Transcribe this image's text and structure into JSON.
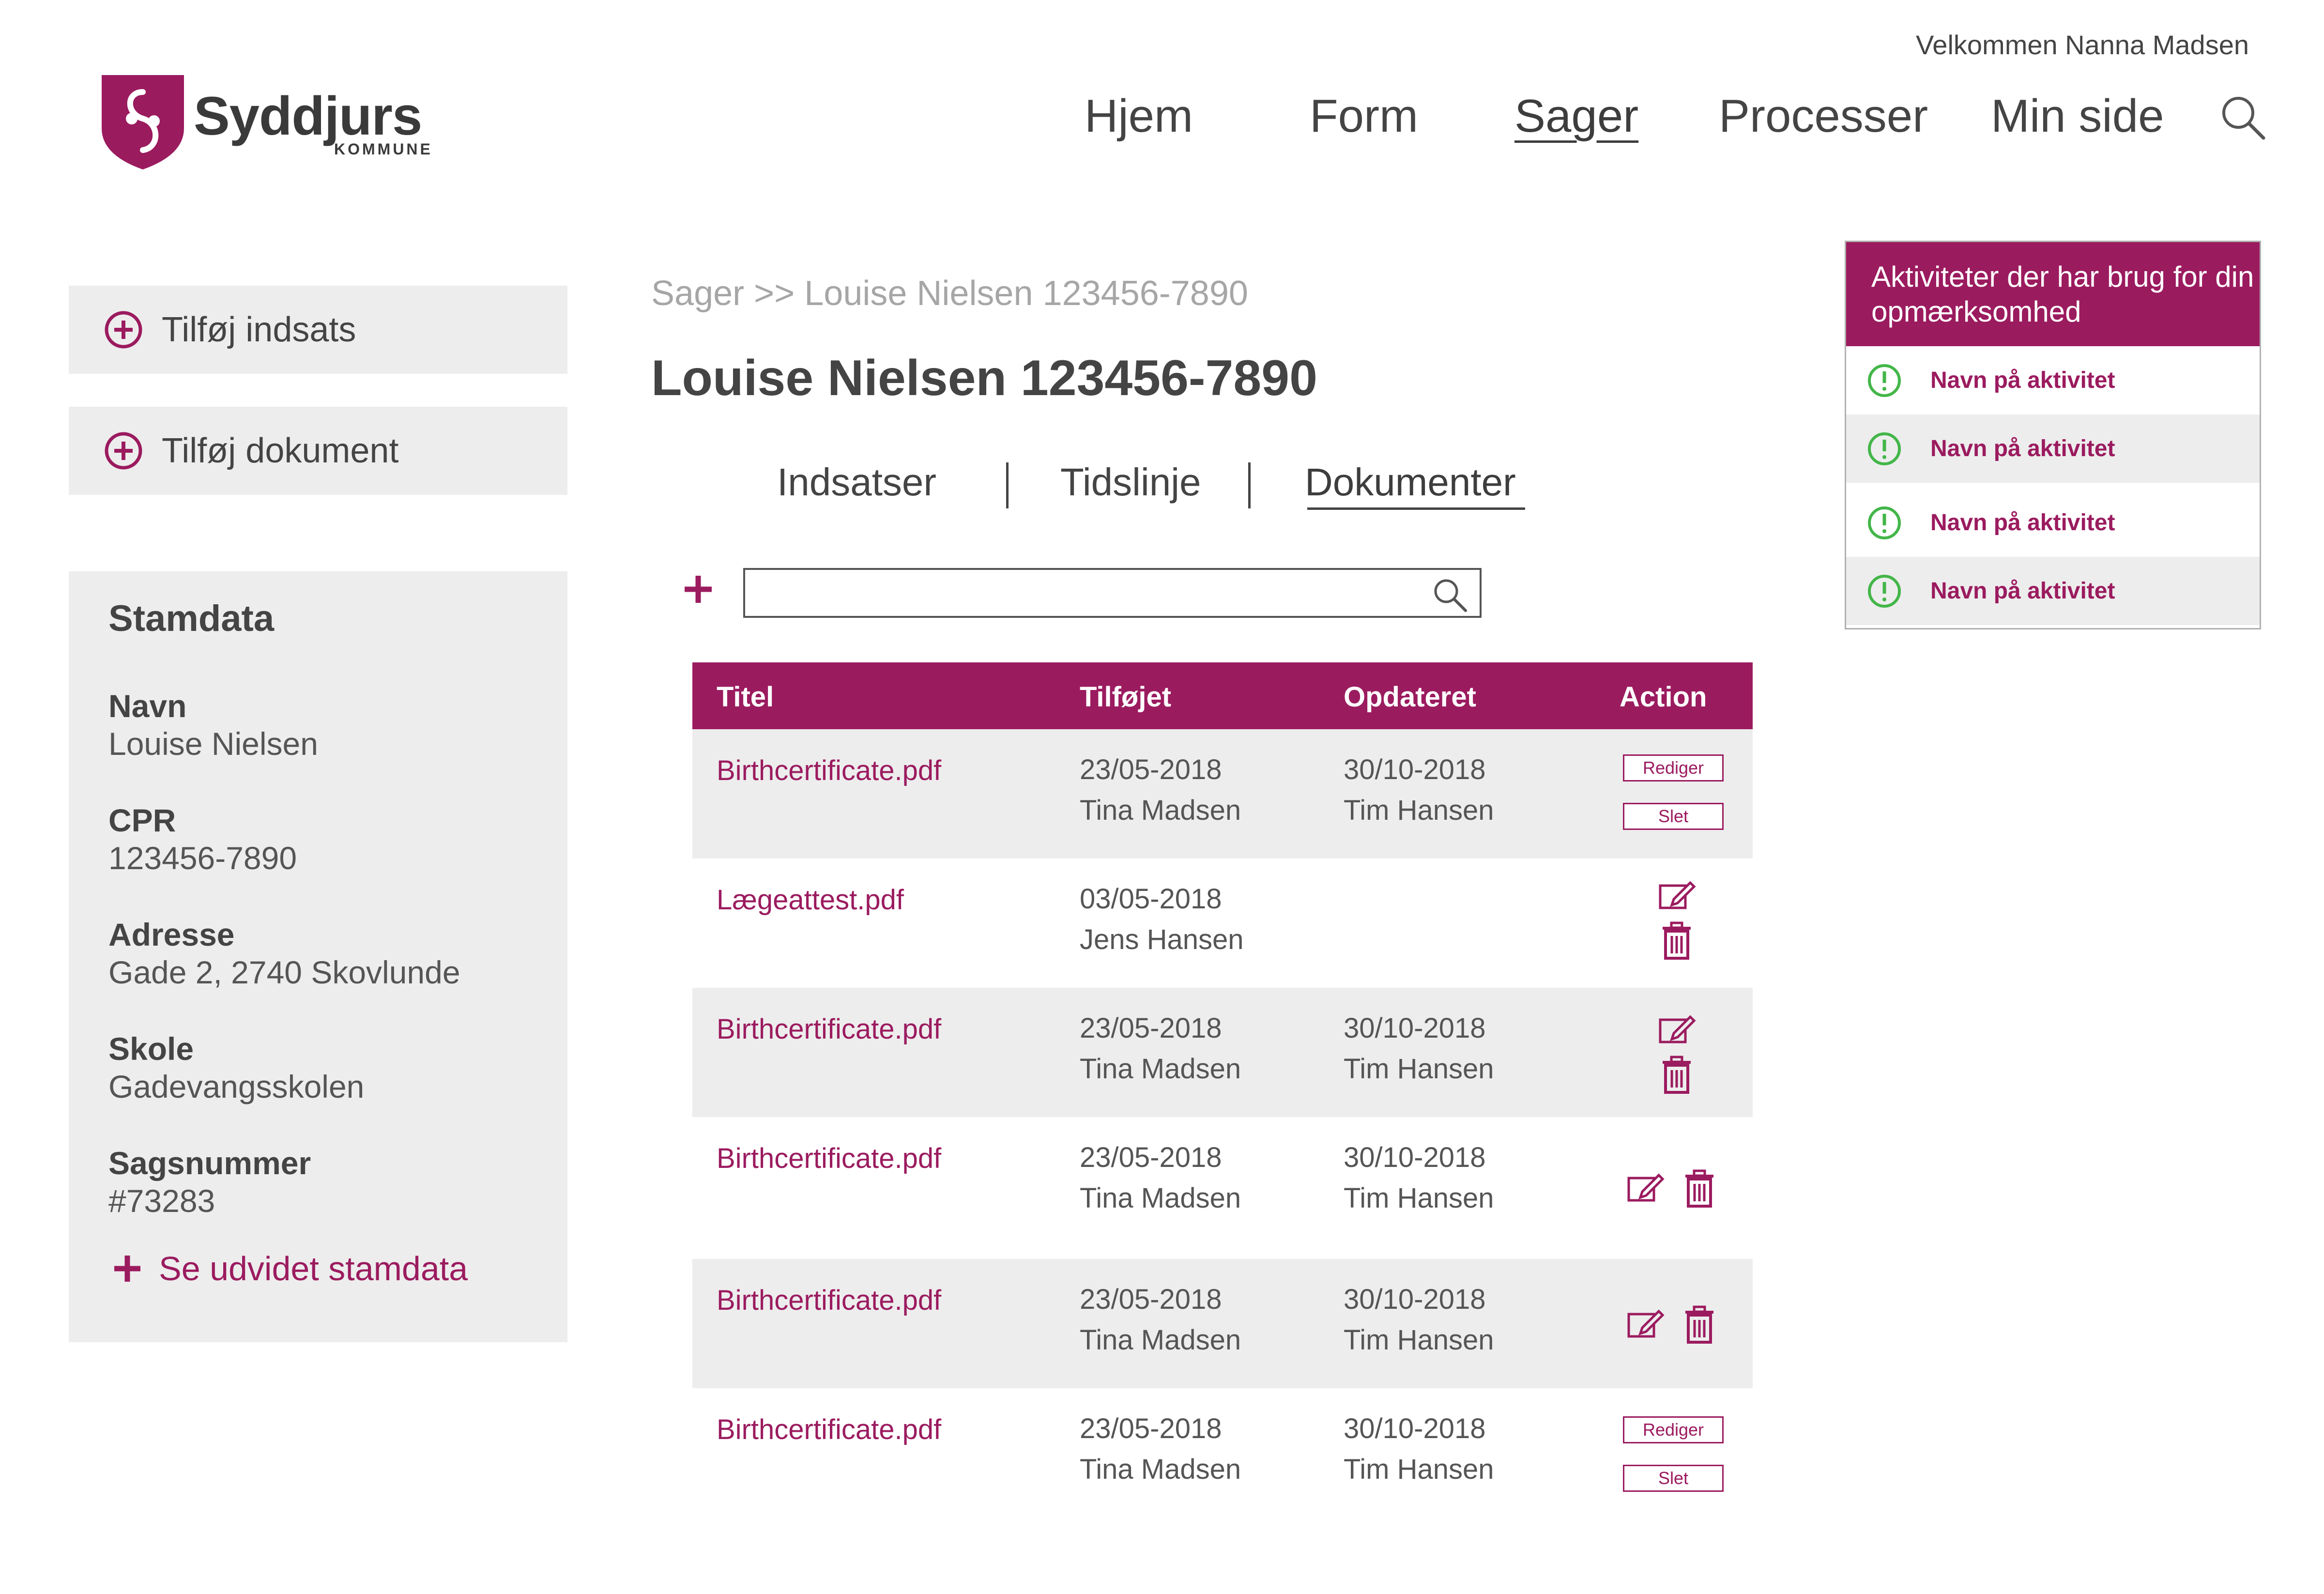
{
  "header": {
    "welcome": "Velkommen Nanna Madsen",
    "logo": {
      "name": "Syddjurs",
      "sub": "KOMMUNE"
    },
    "nav": [
      "Hjem",
      "Form",
      "Sager",
      "Processer",
      "Min side"
    ],
    "active_nav": "Sager"
  },
  "sidebar": {
    "add_effort": "Tilføj indsats",
    "add_document": "Tilføj dokument",
    "stamdata": {
      "title": "Stamdata",
      "fields": [
        {
          "label": "Navn",
          "value": "Louise Nielsen"
        },
        {
          "label": "CPR",
          "value": "123456-7890"
        },
        {
          "label": "Adresse",
          "value": "Gade 2, 2740 Skovlunde"
        },
        {
          "label": "Skole",
          "value": "Gadevangsskolen"
        },
        {
          "label": "Sagsnummer",
          "value": "#73283"
        }
      ],
      "more": "Se udvidet stamdata"
    }
  },
  "main": {
    "breadcrumb": "Sager >> Louise Nielsen 123456-7890",
    "title": "Louise Nielsen 123456-7890",
    "tabs": [
      "Indsatser",
      "Tidslinje",
      "Dokumenter"
    ],
    "active_tab": "Dokumenter",
    "search": {
      "value": "",
      "placeholder": ""
    },
    "table": {
      "headers": {
        "title": "Titel",
        "added": "Tilføjet",
        "updated": "Opdateret",
        "action": "Action"
      },
      "rows": [
        {
          "title": "Birthcertificate.pdf",
          "added_date": "23/05-2018",
          "added_by": "Tina Madsen",
          "updated_date": "30/10-2018",
          "updated_by": "Tim Hansen",
          "actions": [
            "Rediger",
            "Slet"
          ]
        },
        {
          "title": "Lægeattest.pdf",
          "added_date": "03/05-2018",
          "added_by": "Jens Hansen",
          "updated_date": "",
          "updated_by": ""
        },
        {
          "title": "Birthcertificate.pdf",
          "added_date": "23/05-2018",
          "added_by": "Tina Madsen",
          "updated_date": "30/10-2018",
          "updated_by": "Tim Hansen"
        },
        {
          "title": "Birthcertificate.pdf",
          "added_date": "23/05-2018",
          "added_by": "Tina Madsen",
          "updated_date": "30/10-2018",
          "updated_by": "Tim Hansen"
        },
        {
          "title": "Birthcertificate.pdf",
          "added_date": "23/05-2018",
          "added_by": "Tina Madsen",
          "updated_date": "30/10-2018",
          "updated_by": "Tim Hansen"
        },
        {
          "title": "Birthcertificate.pdf",
          "added_date": "23/05-2018",
          "added_by": "Tina Madsen",
          "updated_date": "30/10-2018",
          "updated_by": "Tim Hansen",
          "actions": [
            "Rediger",
            "Slet"
          ]
        }
      ]
    }
  },
  "activities": {
    "title": "Aktiviteter der har brug for din opmærksomhed",
    "items": [
      "Navn på aktivitet",
      "Navn på aktivitet",
      "Navn på aktivitet",
      "Navn på aktivitet"
    ]
  },
  "colors": {
    "accent": "#9b1b5f",
    "panel_grey": "#ededed",
    "alert_green": "#43b649",
    "text": "#444444"
  },
  "icons": [
    "plus-circle-icon",
    "plus-icon",
    "search-icon",
    "edit-icon",
    "trash-icon",
    "alert-circle-icon",
    "shield-logo-icon"
  ]
}
